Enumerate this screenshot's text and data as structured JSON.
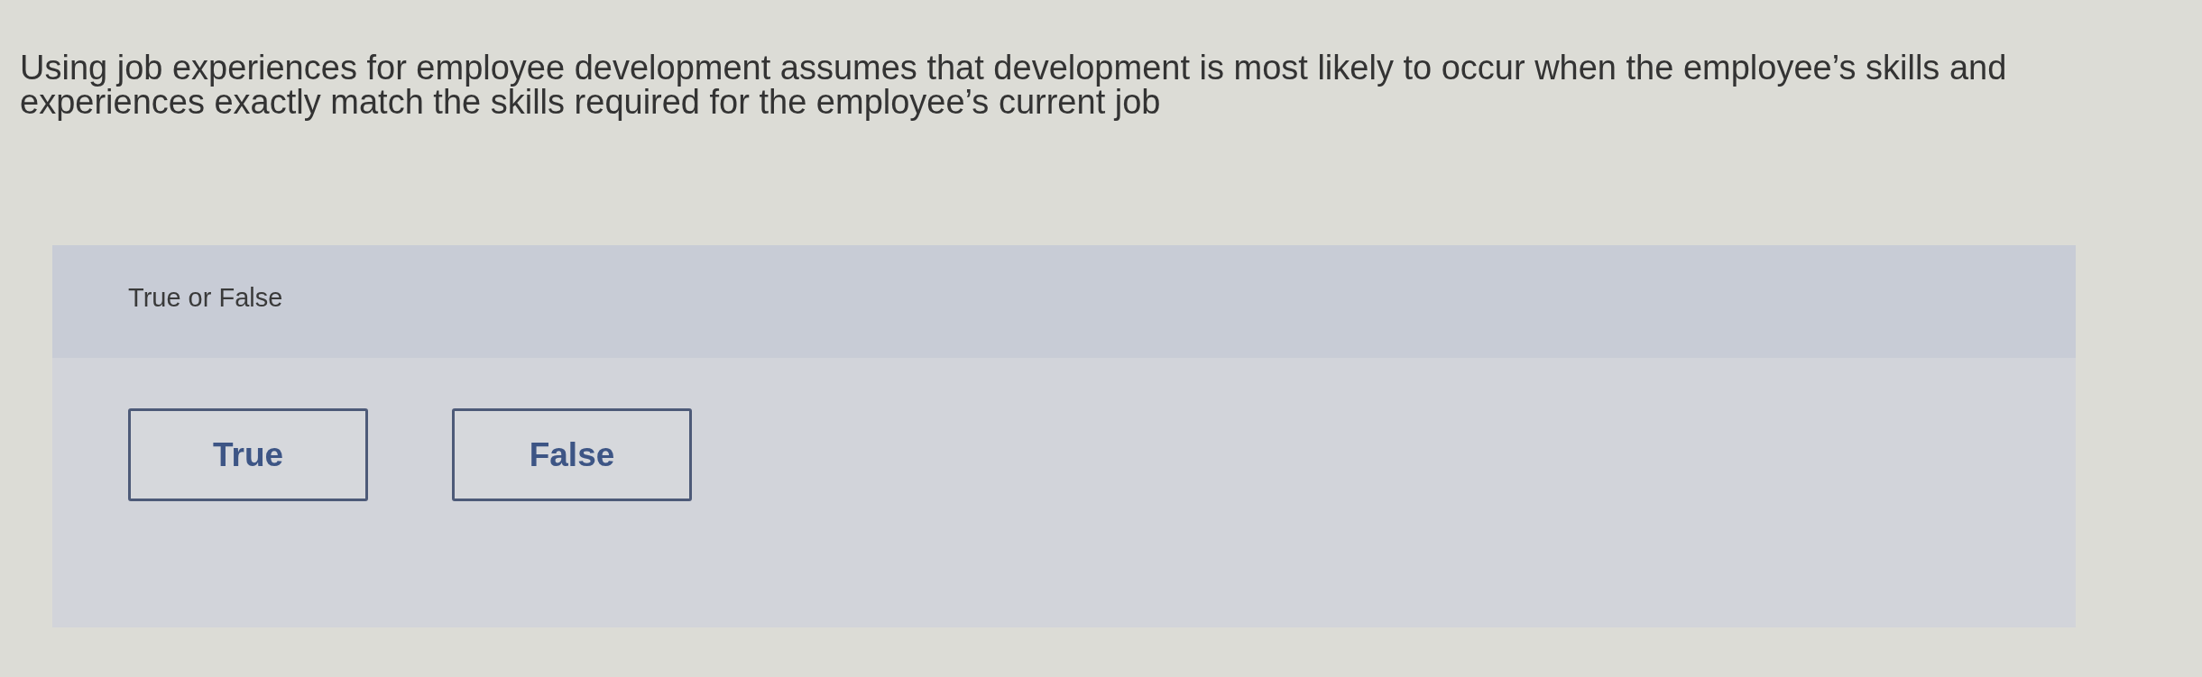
{
  "question": {
    "text": "Using job experiences for employee development assumes that development is most likely to occur when the employee’s skills and experiences exactly match the skills required for the employee’s current job"
  },
  "answer_panel": {
    "prompt": "True or False",
    "options": [
      {
        "label": "True",
        "selected": false
      },
      {
        "label": "False",
        "selected": false
      }
    ]
  }
}
